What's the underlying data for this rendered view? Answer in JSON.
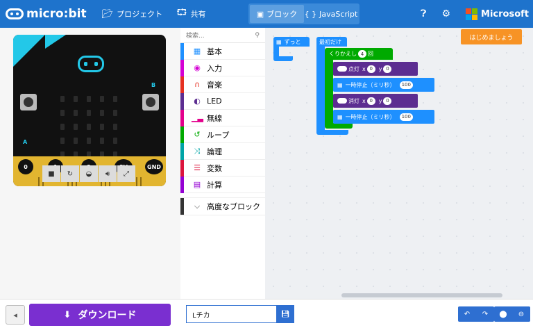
{
  "header": {
    "logo_text": "micro:bit",
    "projects_label": "プロジェクト",
    "share_label": "共有",
    "modes": [
      {
        "label": "ブロック",
        "active": true
      },
      {
        "label": "JavaScript",
        "active": false
      }
    ],
    "microsoft_label": "Microsoft"
  },
  "simulator": {
    "button_a": "A",
    "button_b": "B",
    "pins": [
      "0",
      "1",
      "2",
      "3V",
      "GND"
    ]
  },
  "toolbox": {
    "search_placeholder": "検索...",
    "categories": [
      {
        "label": "基本",
        "color": "#1e90ff",
        "icon": "grid-icon"
      },
      {
        "label": "入力",
        "color": "#d400d4",
        "icon": "target-icon"
      },
      {
        "label": "音楽",
        "color": "#e63022",
        "icon": "headphones-icon"
      },
      {
        "label": "LED",
        "color": "#5c2d91",
        "icon": "toggle-icon"
      },
      {
        "label": "無線",
        "color": "#e3008c",
        "icon": "signal-icon"
      },
      {
        "label": "ループ",
        "color": "#00aa00",
        "icon": "loop-icon"
      },
      {
        "label": "論理",
        "color": "#00a4a6",
        "icon": "shuffle-icon"
      },
      {
        "label": "変数",
        "color": "#dc143c",
        "icon": "list-icon"
      },
      {
        "label": "計算",
        "color": "#9400d3",
        "icon": "calculator-icon"
      }
    ],
    "advanced_label": "高度なブロック"
  },
  "workspace": {
    "start_button": "はじめましょう",
    "forever_label": "ずっと",
    "on_start_label": "最初だけ",
    "repeat_label": "くりかえし",
    "repeat_count": "4",
    "repeat_suffix": "回",
    "plot_label": "点灯",
    "unplot_label": "消灯",
    "x_label": "x",
    "y_label": "y",
    "x_value": "0",
    "y_value": "0",
    "pause_label": "一時停止（ミリ秒）",
    "pause_value": "100",
    "colors": {
      "basic": "#1e90ff",
      "loop": "#00aa00",
      "led": "#5c2d91"
    }
  },
  "bottom": {
    "download_label": "ダウンロード",
    "project_name": "Lチカ"
  }
}
